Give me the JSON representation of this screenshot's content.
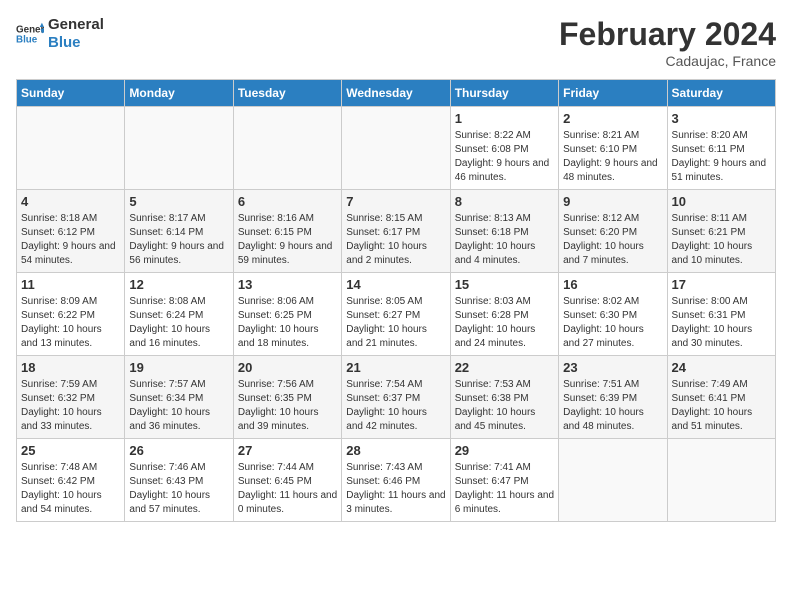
{
  "header": {
    "logo_general": "General",
    "logo_blue": "Blue",
    "month_title": "February 2024",
    "location": "Cadaujac, France"
  },
  "days_of_week": [
    "Sunday",
    "Monday",
    "Tuesday",
    "Wednesday",
    "Thursday",
    "Friday",
    "Saturday"
  ],
  "weeks": [
    [
      {
        "day": "",
        "empty": true
      },
      {
        "day": "",
        "empty": true
      },
      {
        "day": "",
        "empty": true
      },
      {
        "day": "",
        "empty": true
      },
      {
        "day": "1",
        "sunrise": "8:22 AM",
        "sunset": "6:08 PM",
        "daylight": "9 hours and 46 minutes."
      },
      {
        "day": "2",
        "sunrise": "8:21 AM",
        "sunset": "6:10 PM",
        "daylight": "9 hours and 48 minutes."
      },
      {
        "day": "3",
        "sunrise": "8:20 AM",
        "sunset": "6:11 PM",
        "daylight": "9 hours and 51 minutes."
      }
    ],
    [
      {
        "day": "4",
        "sunrise": "8:18 AM",
        "sunset": "6:12 PM",
        "daylight": "9 hours and 54 minutes."
      },
      {
        "day": "5",
        "sunrise": "8:17 AM",
        "sunset": "6:14 PM",
        "daylight": "9 hours and 56 minutes."
      },
      {
        "day": "6",
        "sunrise": "8:16 AM",
        "sunset": "6:15 PM",
        "daylight": "9 hours and 59 minutes."
      },
      {
        "day": "7",
        "sunrise": "8:15 AM",
        "sunset": "6:17 PM",
        "daylight": "10 hours and 2 minutes."
      },
      {
        "day": "8",
        "sunrise": "8:13 AM",
        "sunset": "6:18 PM",
        "daylight": "10 hours and 4 minutes."
      },
      {
        "day": "9",
        "sunrise": "8:12 AM",
        "sunset": "6:20 PM",
        "daylight": "10 hours and 7 minutes."
      },
      {
        "day": "10",
        "sunrise": "8:11 AM",
        "sunset": "6:21 PM",
        "daylight": "10 hours and 10 minutes."
      }
    ],
    [
      {
        "day": "11",
        "sunrise": "8:09 AM",
        "sunset": "6:22 PM",
        "daylight": "10 hours and 13 minutes."
      },
      {
        "day": "12",
        "sunrise": "8:08 AM",
        "sunset": "6:24 PM",
        "daylight": "10 hours and 16 minutes."
      },
      {
        "day": "13",
        "sunrise": "8:06 AM",
        "sunset": "6:25 PM",
        "daylight": "10 hours and 18 minutes."
      },
      {
        "day": "14",
        "sunrise": "8:05 AM",
        "sunset": "6:27 PM",
        "daylight": "10 hours and 21 minutes."
      },
      {
        "day": "15",
        "sunrise": "8:03 AM",
        "sunset": "6:28 PM",
        "daylight": "10 hours and 24 minutes."
      },
      {
        "day": "16",
        "sunrise": "8:02 AM",
        "sunset": "6:30 PM",
        "daylight": "10 hours and 27 minutes."
      },
      {
        "day": "17",
        "sunrise": "8:00 AM",
        "sunset": "6:31 PM",
        "daylight": "10 hours and 30 minutes."
      }
    ],
    [
      {
        "day": "18",
        "sunrise": "7:59 AM",
        "sunset": "6:32 PM",
        "daylight": "10 hours and 33 minutes."
      },
      {
        "day": "19",
        "sunrise": "7:57 AM",
        "sunset": "6:34 PM",
        "daylight": "10 hours and 36 minutes."
      },
      {
        "day": "20",
        "sunrise": "7:56 AM",
        "sunset": "6:35 PM",
        "daylight": "10 hours and 39 minutes."
      },
      {
        "day": "21",
        "sunrise": "7:54 AM",
        "sunset": "6:37 PM",
        "daylight": "10 hours and 42 minutes."
      },
      {
        "day": "22",
        "sunrise": "7:53 AM",
        "sunset": "6:38 PM",
        "daylight": "10 hours and 45 minutes."
      },
      {
        "day": "23",
        "sunrise": "7:51 AM",
        "sunset": "6:39 PM",
        "daylight": "10 hours and 48 minutes."
      },
      {
        "day": "24",
        "sunrise": "7:49 AM",
        "sunset": "6:41 PM",
        "daylight": "10 hours and 51 minutes."
      }
    ],
    [
      {
        "day": "25",
        "sunrise": "7:48 AM",
        "sunset": "6:42 PM",
        "daylight": "10 hours and 54 minutes."
      },
      {
        "day": "26",
        "sunrise": "7:46 AM",
        "sunset": "6:43 PM",
        "daylight": "10 hours and 57 minutes."
      },
      {
        "day": "27",
        "sunrise": "7:44 AM",
        "sunset": "6:45 PM",
        "daylight": "11 hours and 0 minutes."
      },
      {
        "day": "28",
        "sunrise": "7:43 AM",
        "sunset": "6:46 PM",
        "daylight": "11 hours and 3 minutes."
      },
      {
        "day": "29",
        "sunrise": "7:41 AM",
        "sunset": "6:47 PM",
        "daylight": "11 hours and 6 minutes."
      },
      {
        "day": "",
        "empty": true
      },
      {
        "day": "",
        "empty": true
      }
    ]
  ]
}
